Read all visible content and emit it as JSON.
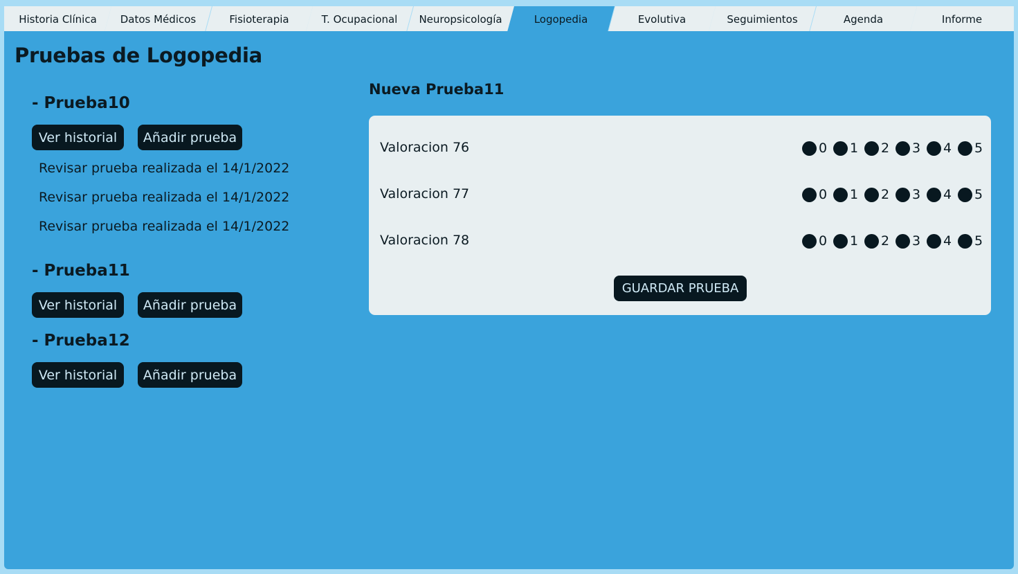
{
  "tabs": [
    {
      "label": "Historia Clínica",
      "active": false
    },
    {
      "label": "Datos Médicos",
      "active": false
    },
    {
      "label": "Fisioterapia",
      "active": false
    },
    {
      "label": "T. Ocupacional",
      "active": false
    },
    {
      "label": "Neuropsicología",
      "active": false
    },
    {
      "label": "Logopedia",
      "active": true
    },
    {
      "label": "Evolutiva",
      "active": false
    },
    {
      "label": "Seguimientos",
      "active": false
    },
    {
      "label": "Agenda",
      "active": false
    },
    {
      "label": "Informe",
      "active": false
    }
  ],
  "page": {
    "title": "Pruebas de Logopedia"
  },
  "tests": [
    {
      "heading": "- Prueba10",
      "history_label": "Ver historial",
      "add_label": "Añadir prueba",
      "reviews": [
        "Revisar prueba realizada el 14/1/2022",
        "Revisar prueba realizada el 14/1/2022",
        "Revisar prueba realizada el 14/1/2022"
      ]
    },
    {
      "heading": "- Prueba11",
      "history_label": "Ver historial",
      "add_label": "Añadir prueba",
      "reviews": []
    },
    {
      "heading": "- Prueba12",
      "history_label": "Ver historial",
      "add_label": "Añadir prueba",
      "reviews": []
    }
  ],
  "new_test": {
    "title": "Nueva Prueba11",
    "rows": [
      {
        "label": "Valoracion 76",
        "options": [
          "0",
          "1",
          "2",
          "3",
          "4",
          "5"
        ]
      },
      {
        "label": "Valoracion 77",
        "options": [
          "0",
          "1",
          "2",
          "3",
          "4",
          "5"
        ]
      },
      {
        "label": "Valoracion 78",
        "options": [
          "0",
          "1",
          "2",
          "3",
          "4",
          "5"
        ]
      }
    ],
    "save_label": "GUARDAR PRUEBA"
  },
  "colors": {
    "background": "#a8dcf5",
    "panel": "#3aa3dc",
    "tab_inactive": "#e8eff1",
    "button_dark": "#081820"
  }
}
